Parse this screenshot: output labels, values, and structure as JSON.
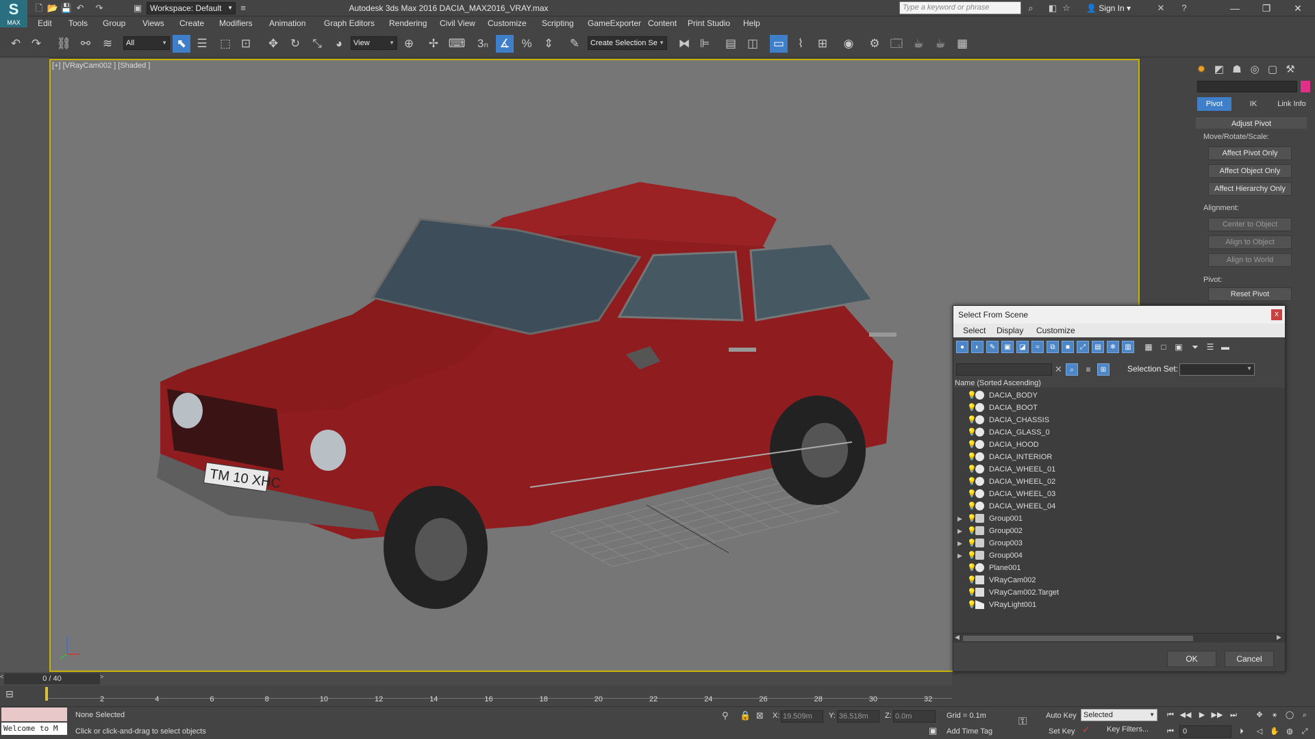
{
  "window": {
    "app_title": "Autodesk 3ds Max 2016    DACIA_MAX2016_VRAY.max",
    "logo_text": "MAX",
    "workspace": "Workspace: Default",
    "search_placeholder": "Type a keyword or phrase",
    "sign_in": "Sign In"
  },
  "menu": [
    "Edit",
    "Tools",
    "Group",
    "Views",
    "Create",
    "Modifiers",
    "Animation",
    "Graph Editors",
    "Rendering",
    "Civil View",
    "Customize",
    "Scripting",
    "GameExporter",
    "Content",
    "Print Studio",
    "Help"
  ],
  "toolbar": {
    "selection_filter": "All",
    "ref_coord": "View",
    "named_selection": "Create Selection Se"
  },
  "viewport": {
    "label": "[+] [VRayCam002 ] [Shaded ]",
    "plate_text": "TM 10 XHC"
  },
  "command_panel": {
    "subtabs": [
      "Pivot",
      "IK",
      "Link Info"
    ],
    "rollout_title": "Adjust Pivot",
    "group1": "Move/Rotate/Scale:",
    "btn_affect_pivot": "Affect Pivot Only",
    "btn_affect_object": "Affect Object Only",
    "btn_affect_hierarchy": "Affect Hierarchy Only",
    "group2": "Alignment:",
    "btn_center": "Center to Object",
    "btn_align_object": "Align to Object",
    "btn_align_world": "Align to World",
    "group3": "Pivot:",
    "btn_reset": "Reset Pivot"
  },
  "dialog": {
    "title": "Select From Scene",
    "close": "x",
    "menus": [
      "Select",
      "Display",
      "Customize"
    ],
    "selection_set_label": "Selection Set:",
    "column_header": "Name (Sorted Ascending)",
    "ok": "OK",
    "cancel": "Cancel",
    "objects": [
      {
        "name": "DACIA_BODY",
        "type": "geo",
        "expandable": false
      },
      {
        "name": "DACIA_BOOT",
        "type": "geo",
        "expandable": false
      },
      {
        "name": "DACIA_CHASSIS",
        "type": "geo",
        "expandable": false
      },
      {
        "name": "DACIA_GLASS_0",
        "type": "geo",
        "expandable": false
      },
      {
        "name": "DACIA_HOOD",
        "type": "geo",
        "expandable": false
      },
      {
        "name": "DACIA_INTERIOR",
        "type": "geo",
        "expandable": false
      },
      {
        "name": "DACIA_WHEEL_01",
        "type": "geo",
        "expandable": false
      },
      {
        "name": "DACIA_WHEEL_02",
        "type": "geo",
        "expandable": false
      },
      {
        "name": "DACIA_WHEEL_03",
        "type": "geo",
        "expandable": false
      },
      {
        "name": "DACIA_WHEEL_04",
        "type": "geo",
        "expandable": false
      },
      {
        "name": "Group001",
        "type": "group",
        "expandable": true
      },
      {
        "name": "Group002",
        "type": "group",
        "expandable": true
      },
      {
        "name": "Group003",
        "type": "group",
        "expandable": true
      },
      {
        "name": "Group004",
        "type": "group",
        "expandable": true
      },
      {
        "name": "Plane001",
        "type": "geo",
        "expandable": false
      },
      {
        "name": "VRayCam002",
        "type": "camera",
        "expandable": false
      },
      {
        "name": "VRayCam002.Target",
        "type": "camera",
        "expandable": false
      },
      {
        "name": "VRayLight001",
        "type": "light",
        "expandable": false
      }
    ]
  },
  "timeline": {
    "slider_text": "0 / 40",
    "ticks": [
      "2",
      "4",
      "6",
      "8",
      "10",
      "12",
      "14",
      "16",
      "18",
      "20",
      "22",
      "24",
      "26",
      "28",
      "30",
      "32"
    ]
  },
  "status": {
    "maxscript_text": "Welcome to M",
    "selection": "None Selected",
    "prompt": "Click or click-and-drag to select objects",
    "x_label": "X:",
    "x_value": "19.509m",
    "y_label": "Y:",
    "y_value": "36.518m",
    "z_label": "Z:",
    "z_value": "0.0m",
    "grid": "Grid = 0.1m",
    "add_time_tag": "Add Time Tag",
    "auto_key": "Auto Key",
    "set_key": "Set Key",
    "key_mode": "Selected",
    "key_filters": "Key Filters...",
    "current_frame": "0"
  },
  "colors": {
    "accent": "#3f7fc9",
    "viewport_border": "#c8b400",
    "car_body": "#8f1d1f",
    "object_color_swatch": "#e0308a"
  }
}
